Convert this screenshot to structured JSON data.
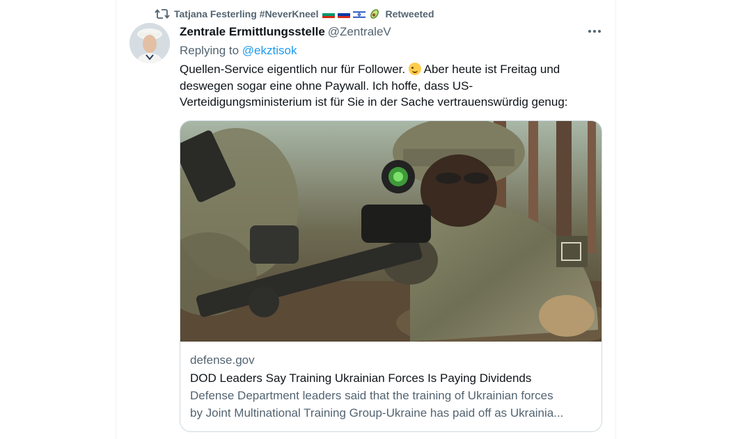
{
  "retweet": {
    "retweeter_name": "Tatjana Festerling #NeverKneel",
    "status": "Retweeted",
    "icons": [
      "retweet-icon",
      "flag-bulgaria",
      "flag-russia",
      "flag-israel",
      "avocado-emoji"
    ]
  },
  "tweet": {
    "author_name": "Zentrale Ermittlungsstelle",
    "author_handle": "@ZentraleV",
    "more_label": "···",
    "replying_to_label": "Replying to",
    "replying_to_handle": "@ekztisok",
    "text_part1": "Quellen-Service eigentlich nur für Follower.",
    "text_emoji": "winking-face-emoji",
    "text_part2": "Aber heute ist Freitag und deswegen sogar eine ohne Paywall. Ich hoffe, dass US-Verteidigungsministerium ist für Sie in der Sache vertrauenswürdig genug:"
  },
  "card": {
    "domain": "defense.gov",
    "title": "DOD Leaders Say Training Ukrainian Forces Is Paying Dividends",
    "description_line1": "Defense Department leaders said that the training of Ukrainian forces",
    "description_line2": "by Joint Multinational Training Group-Ukraine has paid off as Ukrainia..."
  },
  "colors": {
    "text_primary": "#0f1419",
    "text_secondary": "#536471",
    "link": "#1d9bf0",
    "border": "#cfd9de"
  }
}
